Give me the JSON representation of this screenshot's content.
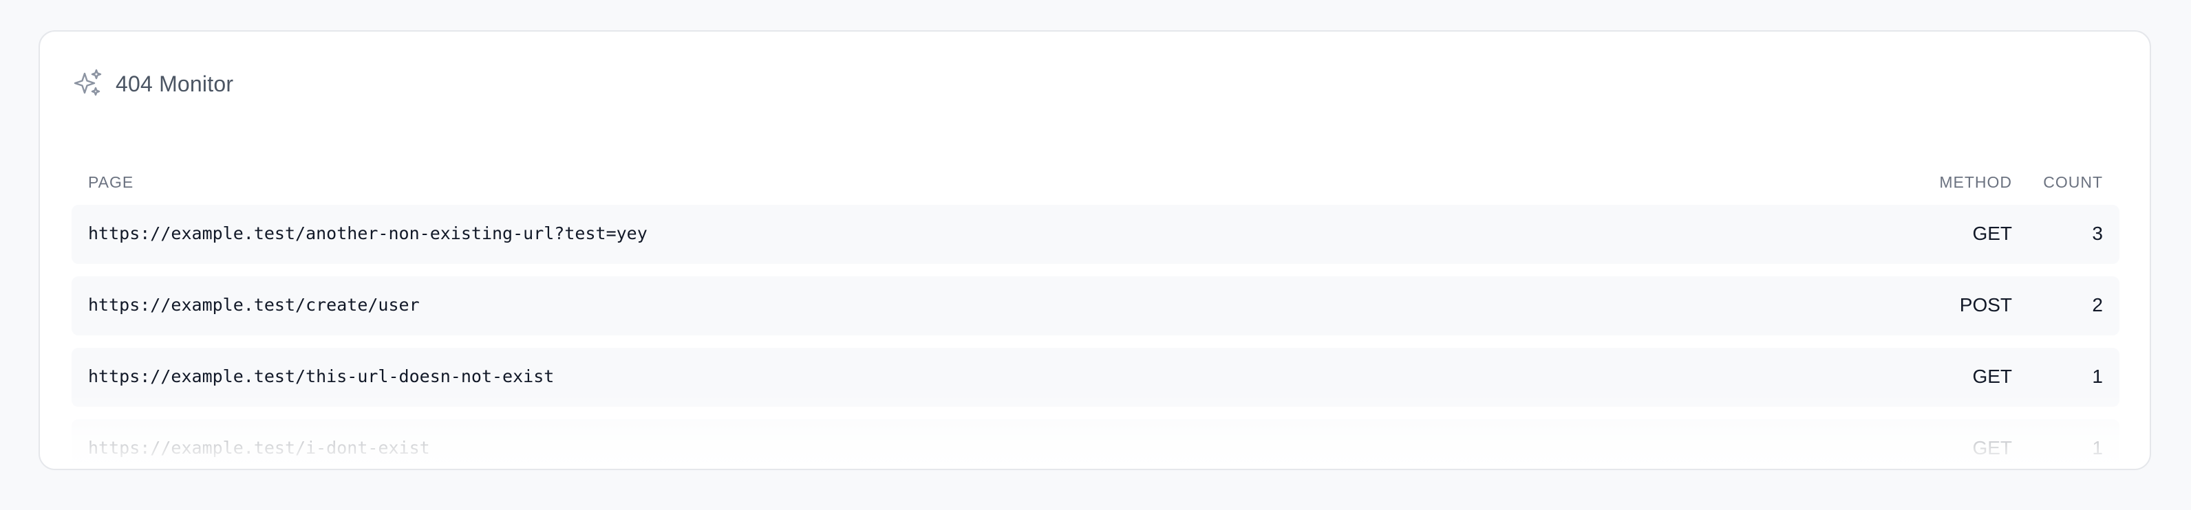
{
  "card": {
    "title": "404 Monitor",
    "icon": "sparkles-icon"
  },
  "table": {
    "headers": {
      "page": "PAGE",
      "method": "METHOD",
      "count": "COUNT"
    },
    "rows": [
      {
        "url": "https://example.test/another-non-existing-url?test=yey",
        "method": "GET",
        "count": "3"
      },
      {
        "url": "https://example.test/create/user",
        "method": "POST",
        "count": "2"
      },
      {
        "url": "https://example.test/this-url-doesn-not-exist",
        "method": "GET",
        "count": "1"
      },
      {
        "url": "https://example.test/i-dont-exist",
        "method": "GET",
        "count": "1"
      }
    ]
  },
  "colors": {
    "page_background": "#f8f9fb",
    "card_background": "#ffffff",
    "row_background": "#f8f9fb",
    "muted_text": "#6b7280",
    "primary_text": "#111827"
  }
}
